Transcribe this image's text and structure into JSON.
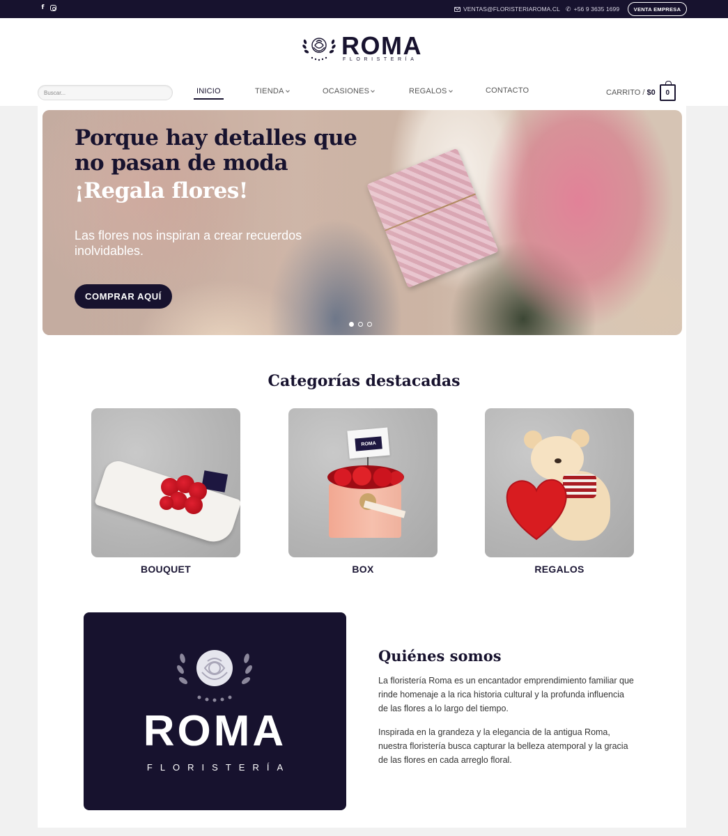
{
  "topbar": {
    "email": "VENTAS@FLORISTERIAROMA.CL",
    "phone": "+56 9 3635 1699",
    "venta_empresa": "VENTA EMPRESA"
  },
  "header": {
    "logo_text": "ROMA",
    "logo_tagline": "FLORISTERÍA",
    "search_placeholder": "Buscar...",
    "nav": {
      "inicio": "INICIO",
      "tienda": "TIENDA",
      "ocasiones": "OCASIONES",
      "regalos": "REGALOS",
      "contacto": "CONTACTO"
    },
    "cart_label": "CARRITO /",
    "cart_amount": "$0",
    "cart_count": "0"
  },
  "hero": {
    "headline": "Porque hay detalles que no pasan de moda",
    "subheadline": "¡Regala flores!",
    "body": "Las flores nos inspiran a crear recuerdos inolvidables.",
    "cta": "COMPRAR AQUÍ",
    "slide_count": 3,
    "active_slide": 1
  },
  "categories": {
    "title": "Categorías destacadas",
    "items": [
      {
        "label": "BOUQUET"
      },
      {
        "label": "BOX"
      },
      {
        "label": "REGALOS"
      }
    ],
    "box_tag_text": "ROMA"
  },
  "about": {
    "logo_text": "ROMA",
    "logo_tagline": "FLORISTERÍA",
    "title": "Quiénes somos",
    "paragraph1": "La floristería Roma es un encantador emprendimiento familiar que rinde homenaje a la rica historia cultural y la profunda influencia de las flores a lo largo del tiempo.",
    "paragraph2": "Inspirada en la grandeza y la elegancia de la antigua Roma, nuestra floristería busca capturar la belleza atemporal y la gracia de las flores en cada arreglo floral."
  },
  "colors": {
    "brand_navy": "#17122e",
    "page_bg": "#f1f1f1"
  },
  "icons": [
    "facebook-icon",
    "instagram-icon",
    "mail-icon",
    "phone-icon",
    "cart-icon",
    "chevron-down-icon",
    "rose-logo-icon"
  ]
}
